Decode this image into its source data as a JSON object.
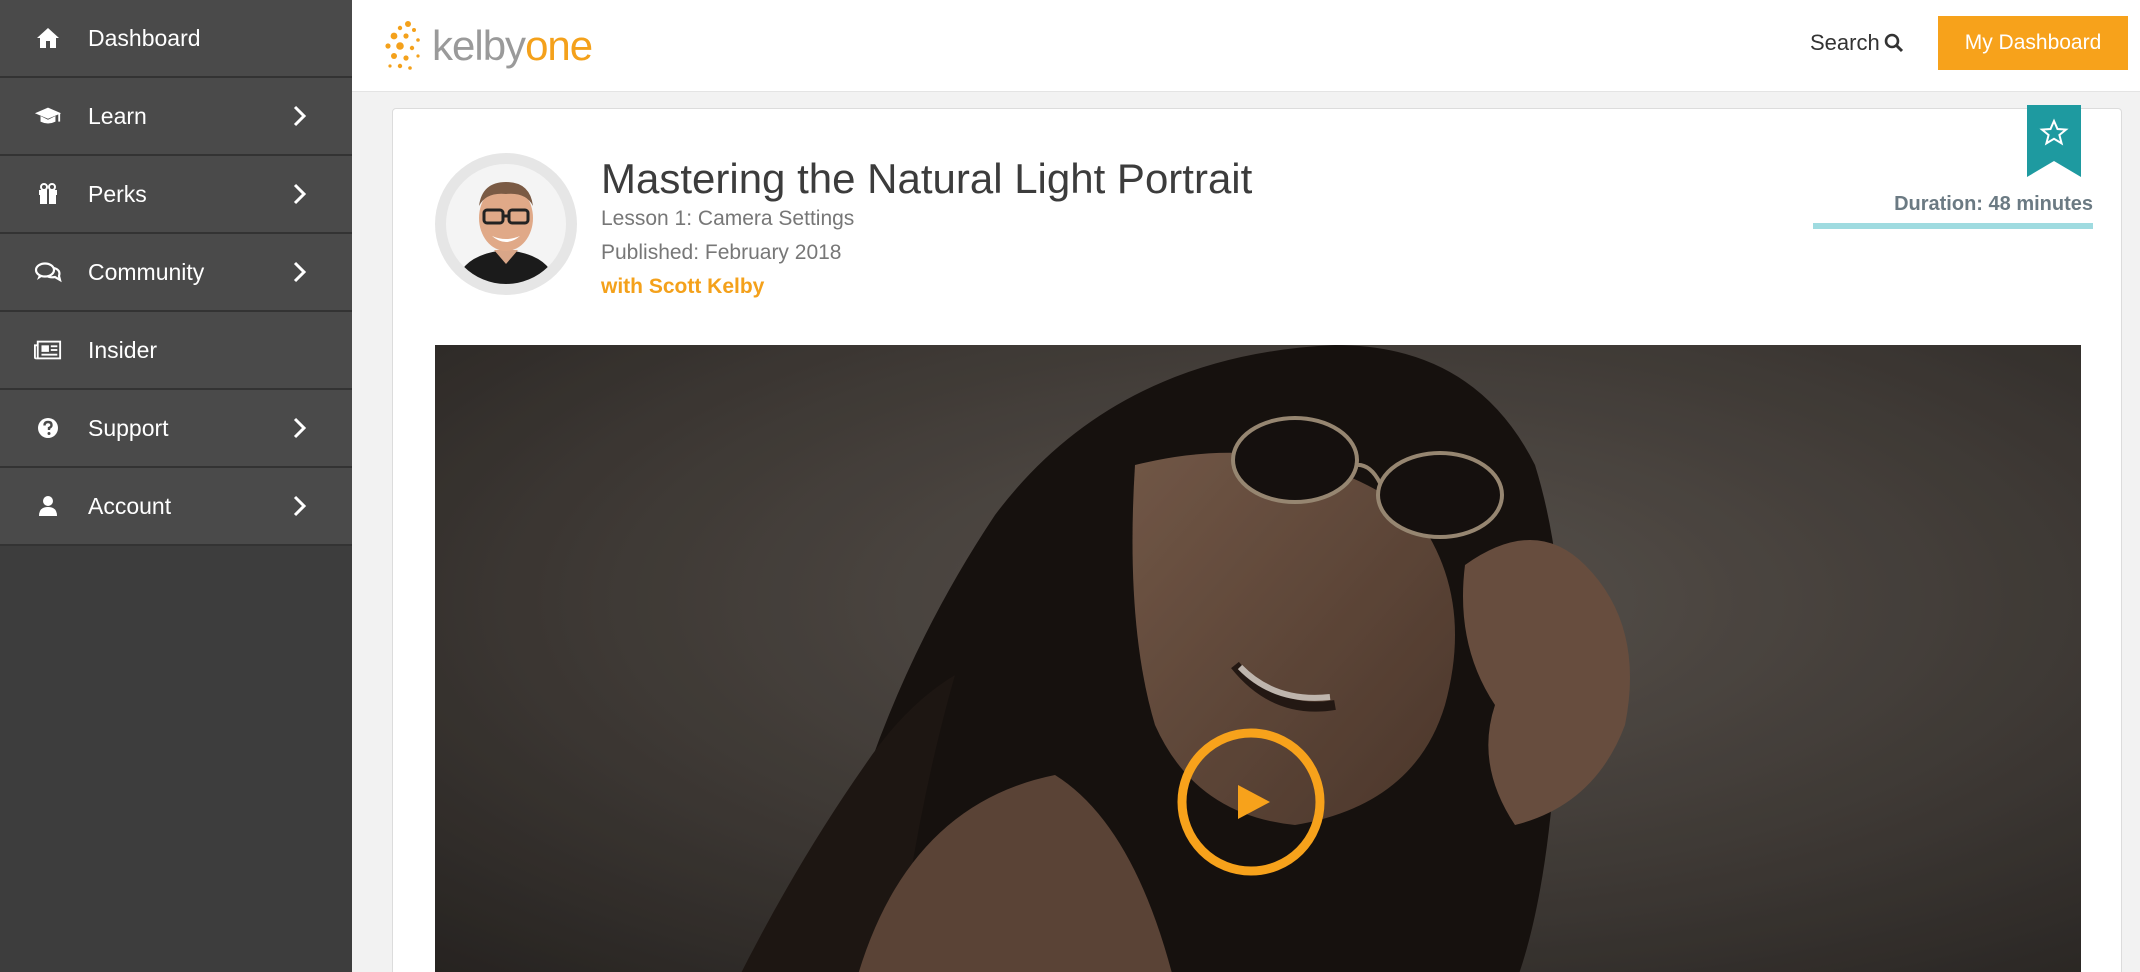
{
  "sidebar": {
    "items": [
      {
        "label": "Dashboard",
        "icon": "home-icon",
        "has_chevron": false
      },
      {
        "label": "Learn",
        "icon": "graduation-cap-icon",
        "has_chevron": true
      },
      {
        "label": "Perks",
        "icon": "gift-icon",
        "has_chevron": true
      },
      {
        "label": "Community",
        "icon": "chat-bubbles-icon",
        "has_chevron": true
      },
      {
        "label": "Insider",
        "icon": "newspaper-icon",
        "has_chevron": false
      },
      {
        "label": "Support",
        "icon": "question-circle-icon",
        "has_chevron": true
      },
      {
        "label": "Account",
        "icon": "user-icon",
        "has_chevron": true
      }
    ]
  },
  "header": {
    "logo_part1": "kelby",
    "logo_part2": "one",
    "search_label": "Search",
    "dashboard_button": "My Dashboard"
  },
  "course": {
    "title": "Mastering the Natural Light Portrait",
    "lesson": "Lesson 1: Camera Settings",
    "published": "Published: February 2018",
    "instructor": "with Scott Kelby",
    "duration": "Duration: 48 minutes"
  },
  "colors": {
    "accent": "#f7a21b",
    "sidebar_bg": "#4a4a4a",
    "bookmark": "#1e9aa0",
    "duration_bar": "#9fdbe0"
  }
}
